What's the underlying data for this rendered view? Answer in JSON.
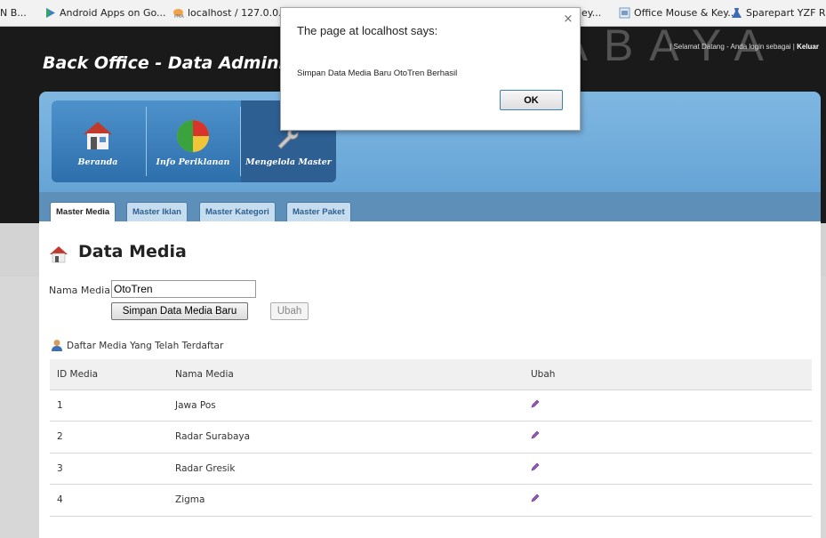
{
  "bookmarks": [
    {
      "label": "N B...",
      "icon": "none"
    },
    {
      "label": "Android Apps on Go...",
      "icon": "play-store-icon"
    },
    {
      "label": "localhost / 127.0.0.1 ...",
      "icon": "phpmyadmin-icon"
    },
    {
      "label": "ey...",
      "icon": "none"
    },
    {
      "label": "Office Mouse & Key...",
      "icon": "mouse-icon"
    },
    {
      "label": "Sparepart YZF R15",
      "icon": "bike-icon"
    }
  ],
  "header": {
    "title": "Back Office - Data Adminis",
    "welcome_prefix": "| Selamat Datang - Anda login sebagai |",
    "logout_label": "Keluar"
  },
  "watermark": "SURABAYA",
  "nav": {
    "items": [
      {
        "label": "Beranda",
        "icon": "home-icon"
      },
      {
        "label": "Info Periklanan",
        "icon": "pie-chart-icon"
      },
      {
        "label": "Mengelola Master",
        "icon": "wrench-icon"
      }
    ]
  },
  "tabs": [
    "Master Media",
    "Master Iklan",
    "Master Kategori",
    "Master Paket"
  ],
  "page": {
    "title": "Data Media",
    "name_label": "Nama Media:",
    "name_value": "OtoTren",
    "save_label": "Simpan Data Media Baru",
    "edit_label": "Ubah",
    "list_heading": "Daftar Media Yang Telah Terdaftar"
  },
  "table": {
    "headers": [
      "ID Media",
      "Nama Media",
      "Ubah"
    ],
    "rows": [
      {
        "id": "1",
        "name": "Jawa Pos"
      },
      {
        "id": "2",
        "name": "Radar Surabaya"
      },
      {
        "id": "3",
        "name": "Radar Gresik"
      },
      {
        "id": "4",
        "name": "Zigma"
      }
    ]
  },
  "dialog": {
    "title": "The page at localhost says:",
    "message": "Simpan Data Media Baru OtoTren Berhasil",
    "ok_label": "OK",
    "close_glyph": "×"
  },
  "colors": {
    "nav_blue": "#5e9ed3",
    "active_menu": "#2e5f93",
    "header_dark": "#1a1a1a"
  }
}
